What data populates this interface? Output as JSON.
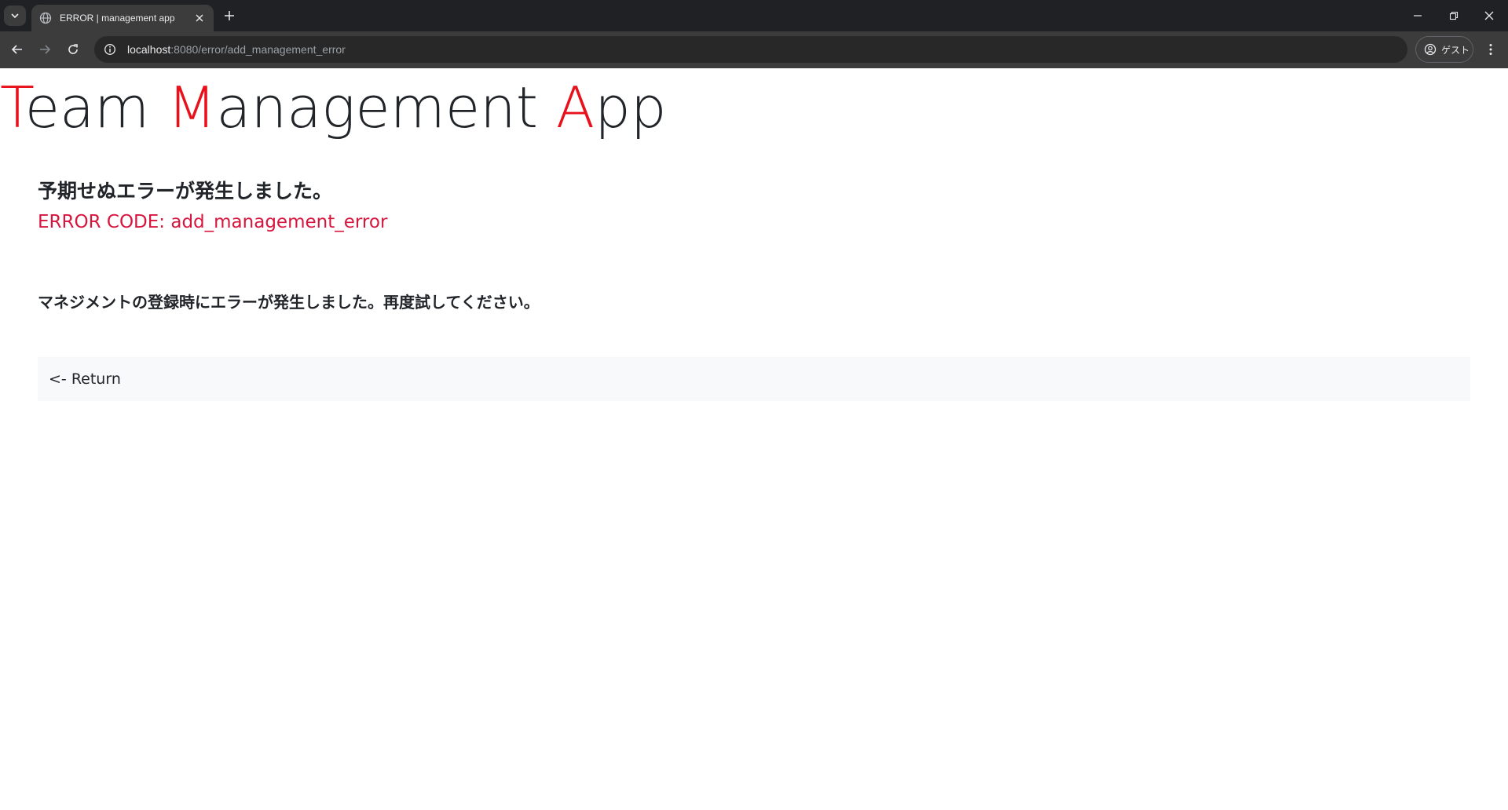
{
  "browser": {
    "tab_title": "ERROR | management app",
    "url_host": "localhost",
    "url_path": ":8080/error/add_management_error",
    "profile_label": "ゲスト"
  },
  "app": {
    "title_parts": [
      {
        "cap": "T",
        "rest": "eam "
      },
      {
        "cap": "M",
        "rest": "anagement "
      },
      {
        "cap": "A",
        "rest": "pp"
      }
    ],
    "accent_color": "#e8101a"
  },
  "error": {
    "heading": "予期せぬエラーが発生しました。",
    "code_text": "ERROR CODE: add_management_error",
    "code_color": "#d6163e",
    "message": "マネジメントの登録時にエラーが発生しました。再度試してください。",
    "return_label": "<- Return"
  }
}
